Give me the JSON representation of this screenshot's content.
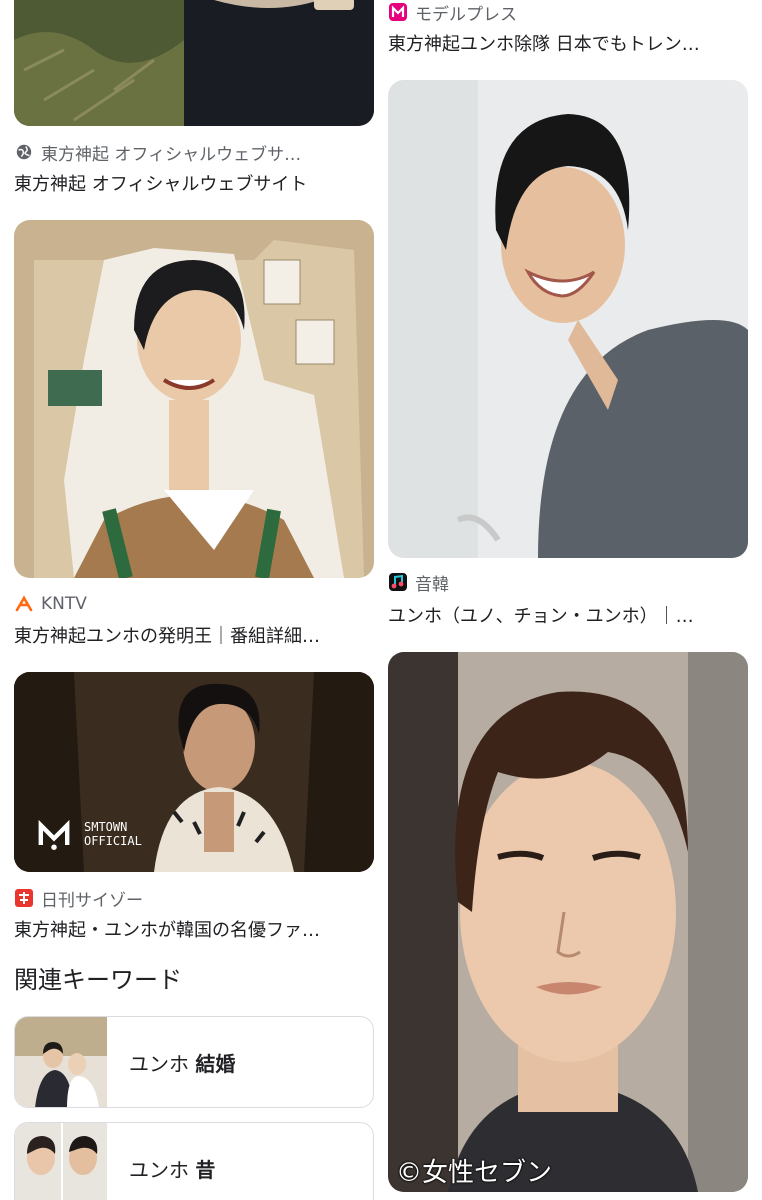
{
  "results_left": [
    {
      "source": "東方神起 オフィシャルウェブサ…",
      "caption": "東方神起 オフィシャルウェブサイト",
      "icon": "globe-icon"
    },
    {
      "source": "KNTV",
      "caption": "東方神起ユンホの発明王｜番組詳細…",
      "icon": "kntv-logo-icon"
    },
    {
      "source": "日刊サイゾー",
      "caption": "東方神起・ユンホが韓国の名優ファ…",
      "icon": "cyzo-logo-icon",
      "image_overlay_text": [
        "SMTOWN",
        "OFFICIAL"
      ]
    }
  ],
  "results_right": [
    {
      "source": "モデルプレス",
      "caption": "東方神起ユンホ除隊 日本でもトレン…",
      "icon": "modelpress-logo-icon"
    },
    {
      "source": "音韓",
      "caption": "ユンホ（ユノ、チョン・ユンホ）｜…",
      "icon": "onkan-logo-icon"
    },
    {
      "source": "",
      "caption": "",
      "image_overlay_text": [
        "©女性セブン"
      ]
    }
  ],
  "related": {
    "title": "関連キーワード",
    "items": [
      {
        "prefix": "ユンホ ",
        "bold": "結婚"
      },
      {
        "prefix": "ユンホ ",
        "bold": "昔"
      }
    ]
  },
  "colors": {
    "text": "#202124",
    "muted": "#5f6368",
    "border": "#dadce0",
    "modelpress": "#e6007e",
    "kntv": "#ff6a13",
    "cyzo": "#e8352e"
  }
}
